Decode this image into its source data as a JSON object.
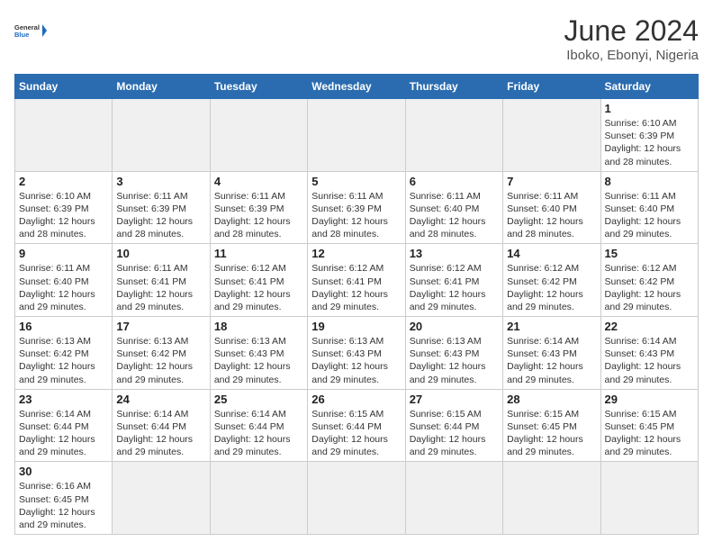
{
  "header": {
    "logo_general": "General",
    "logo_blue": "Blue",
    "month_title": "June 2024",
    "location": "Iboko, Ebonyi, Nigeria"
  },
  "days_of_week": [
    "Sunday",
    "Monday",
    "Tuesday",
    "Wednesday",
    "Thursday",
    "Friday",
    "Saturday"
  ],
  "weeks": [
    [
      null,
      null,
      null,
      null,
      null,
      null,
      {
        "day": 1,
        "sunrise": "6:10 AM",
        "sunset": "6:39 PM",
        "daylight_h": 12,
        "daylight_m": 28
      }
    ],
    [
      {
        "day": 2,
        "sunrise": "6:10 AM",
        "sunset": "6:39 PM",
        "daylight_h": 12,
        "daylight_m": 28
      },
      {
        "day": 3,
        "sunrise": "6:11 AM",
        "sunset": "6:39 PM",
        "daylight_h": 12,
        "daylight_m": 28
      },
      {
        "day": 4,
        "sunrise": "6:11 AM",
        "sunset": "6:39 PM",
        "daylight_h": 12,
        "daylight_m": 28
      },
      {
        "day": 5,
        "sunrise": "6:11 AM",
        "sunset": "6:39 PM",
        "daylight_h": 12,
        "daylight_m": 28
      },
      {
        "day": 6,
        "sunrise": "6:11 AM",
        "sunset": "6:40 PM",
        "daylight_h": 12,
        "daylight_m": 28
      },
      {
        "day": 7,
        "sunrise": "6:11 AM",
        "sunset": "6:40 PM",
        "daylight_h": 12,
        "daylight_m": 28
      },
      {
        "day": 8,
        "sunrise": "6:11 AM",
        "sunset": "6:40 PM",
        "daylight_h": 12,
        "daylight_m": 29
      }
    ],
    [
      {
        "day": 9,
        "sunrise": "6:11 AM",
        "sunset": "6:40 PM",
        "daylight_h": 12,
        "daylight_m": 29
      },
      {
        "day": 10,
        "sunrise": "6:11 AM",
        "sunset": "6:41 PM",
        "daylight_h": 12,
        "daylight_m": 29
      },
      {
        "day": 11,
        "sunrise": "6:12 AM",
        "sunset": "6:41 PM",
        "daylight_h": 12,
        "daylight_m": 29
      },
      {
        "day": 12,
        "sunrise": "6:12 AM",
        "sunset": "6:41 PM",
        "daylight_h": 12,
        "daylight_m": 29
      },
      {
        "day": 13,
        "sunrise": "6:12 AM",
        "sunset": "6:41 PM",
        "daylight_h": 12,
        "daylight_m": 29
      },
      {
        "day": 14,
        "sunrise": "6:12 AM",
        "sunset": "6:42 PM",
        "daylight_h": 12,
        "daylight_m": 29
      },
      {
        "day": 15,
        "sunrise": "6:12 AM",
        "sunset": "6:42 PM",
        "daylight_h": 12,
        "daylight_m": 29
      }
    ],
    [
      {
        "day": 16,
        "sunrise": "6:13 AM",
        "sunset": "6:42 PM",
        "daylight_h": 12,
        "daylight_m": 29
      },
      {
        "day": 17,
        "sunrise": "6:13 AM",
        "sunset": "6:42 PM",
        "daylight_h": 12,
        "daylight_m": 29
      },
      {
        "day": 18,
        "sunrise": "6:13 AM",
        "sunset": "6:43 PM",
        "daylight_h": 12,
        "daylight_m": 29
      },
      {
        "day": 19,
        "sunrise": "6:13 AM",
        "sunset": "6:43 PM",
        "daylight_h": 12,
        "daylight_m": 29
      },
      {
        "day": 20,
        "sunrise": "6:13 AM",
        "sunset": "6:43 PM",
        "daylight_h": 12,
        "daylight_m": 29
      },
      {
        "day": 21,
        "sunrise": "6:14 AM",
        "sunset": "6:43 PM",
        "daylight_h": 12,
        "daylight_m": 29
      },
      {
        "day": 22,
        "sunrise": "6:14 AM",
        "sunset": "6:43 PM",
        "daylight_h": 12,
        "daylight_m": 29
      }
    ],
    [
      {
        "day": 23,
        "sunrise": "6:14 AM",
        "sunset": "6:44 PM",
        "daylight_h": 12,
        "daylight_m": 29
      },
      {
        "day": 24,
        "sunrise": "6:14 AM",
        "sunset": "6:44 PM",
        "daylight_h": 12,
        "daylight_m": 29
      },
      {
        "day": 25,
        "sunrise": "6:14 AM",
        "sunset": "6:44 PM",
        "daylight_h": 12,
        "daylight_m": 29
      },
      {
        "day": 26,
        "sunrise": "6:15 AM",
        "sunset": "6:44 PM",
        "daylight_h": 12,
        "daylight_m": 29
      },
      {
        "day": 27,
        "sunrise": "6:15 AM",
        "sunset": "6:44 PM",
        "daylight_h": 12,
        "daylight_m": 29
      },
      {
        "day": 28,
        "sunrise": "6:15 AM",
        "sunset": "6:45 PM",
        "daylight_h": 12,
        "daylight_m": 29
      },
      {
        "day": 29,
        "sunrise": "6:15 AM",
        "sunset": "6:45 PM",
        "daylight_h": 12,
        "daylight_m": 29
      }
    ],
    [
      {
        "day": 30,
        "sunrise": "6:16 AM",
        "sunset": "6:45 PM",
        "daylight_h": 12,
        "daylight_m": 29
      },
      null,
      null,
      null,
      null,
      null,
      null
    ]
  ]
}
